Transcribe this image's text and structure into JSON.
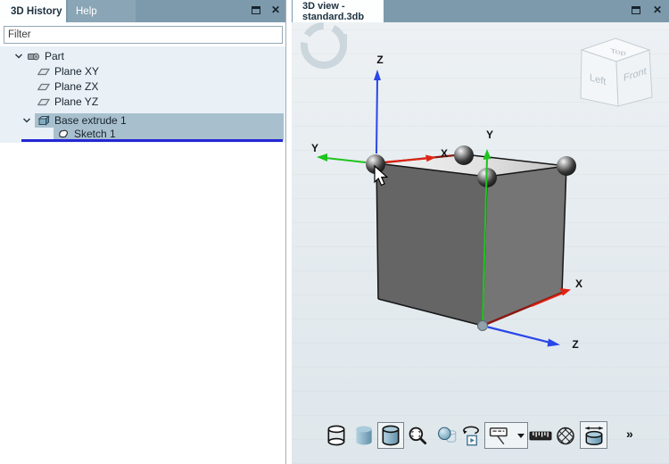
{
  "window": {
    "left_panel": {
      "tabs": [
        {
          "label": "3D History",
          "active": true
        },
        {
          "label": "Help",
          "active": false
        }
      ],
      "filter": {
        "placeholder": "Filter",
        "value": ""
      },
      "tree": {
        "items": [
          {
            "label": "Part",
            "level": 0,
            "expanded": true,
            "icon": "part-icon",
            "selected": false
          },
          {
            "label": "Plane XY",
            "level": 1,
            "icon": "plane-icon",
            "selected": false
          },
          {
            "label": "Plane ZX",
            "level": 1,
            "icon": "plane-icon",
            "selected": false
          },
          {
            "label": "Plane YZ",
            "level": 1,
            "icon": "plane-icon",
            "selected": false
          },
          {
            "label": "Base extrude 1",
            "level": 1,
            "expanded": true,
            "icon": "extrude-icon",
            "selected": true
          },
          {
            "label": "Sketch 1",
            "level": 2,
            "icon": "sketch-icon",
            "selected": true
          }
        ]
      }
    },
    "right_panel": {
      "tab": {
        "label": "3D view - standard.3db",
        "active": true
      },
      "view_cube": {
        "left_face": "Left",
        "front_face": "Front",
        "top_face": "Top"
      },
      "axes": {
        "world_frame": {
          "x": "X",
          "y": "Y",
          "z": "Z"
        },
        "sketch_frame": {
          "x": "X",
          "y": "Y",
          "z": "Z"
        }
      },
      "toolbar": {
        "buttons": [
          {
            "name": "display-wireframe",
            "selected": false
          },
          {
            "name": "display-shaded",
            "selected": false
          },
          {
            "name": "display-shaded-with-edges",
            "selected": true
          },
          {
            "name": "zoom-magnifier",
            "selected": false
          },
          {
            "name": "show-transparency",
            "selected": false
          },
          {
            "name": "turntable-animation",
            "selected": false
          },
          {
            "name": "annotation-display-dropdown",
            "selected": true
          },
          {
            "name": "measure-ruler",
            "selected": false
          },
          {
            "name": "mesh-display",
            "selected": false
          },
          {
            "name": "cylinder-dimension",
            "selected": true
          }
        ],
        "overflow_label": "»"
      }
    },
    "titlebar_icons": {
      "close_glyph": "✕"
    }
  },
  "colors": {
    "titlebar": "#7d9aac",
    "selection": "#a8c0ce",
    "insertion_line": "#2526d4",
    "axis_x": "#e02414",
    "axis_y": "#1ec41e",
    "axis_z": "#2a46e8",
    "sketch_edge": "#8c1710",
    "cube_face_left": "#656565",
    "cube_face_right": "#757575"
  }
}
